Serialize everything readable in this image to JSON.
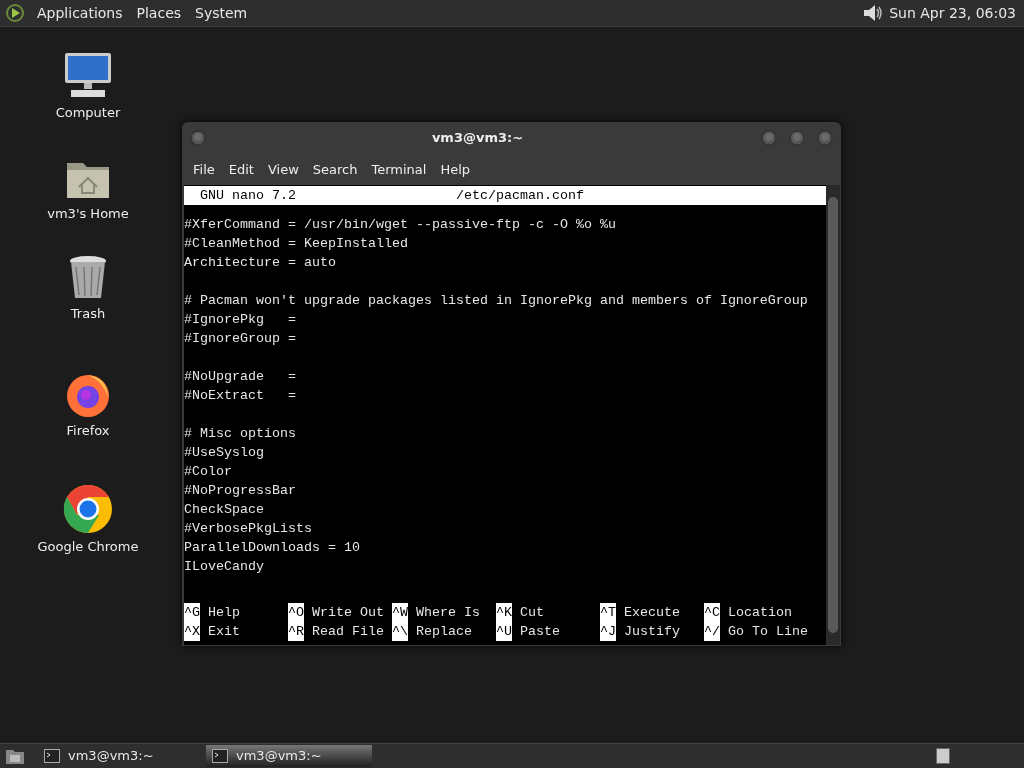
{
  "top_panel": {
    "menus": [
      "Applications",
      "Places",
      "System"
    ],
    "clock": "Sun Apr 23, 06:03"
  },
  "desktop_icons": [
    {
      "kind": "computer",
      "label": "Computer"
    },
    {
      "kind": "home",
      "label": "vm3's Home"
    },
    {
      "kind": "trash",
      "label": "Trash"
    },
    {
      "kind": "firefox",
      "label": "Firefox"
    },
    {
      "kind": "chrome",
      "label": "Google Chrome"
    }
  ],
  "window": {
    "title": "vm3@vm3:~",
    "menu": [
      "File",
      "Edit",
      "View",
      "Search",
      "Terminal",
      "Help"
    ],
    "nano": {
      "version": "GNU nano 7.2",
      "filename": "/etc/pacman.conf",
      "blocks": [
        [
          "#XferCommand = /usr/bin/wget --passive-ftp -c -O %o %u",
          "#CleanMethod = KeepInstalled",
          "Architecture = auto"
        ],
        [
          "# Pacman won't upgrade packages listed in IgnorePkg and members of IgnoreGroup",
          "#IgnorePkg   =",
          "#IgnoreGroup ="
        ],
        [
          "#NoUpgrade   =",
          "#NoExtract   ="
        ],
        [
          "# Misc options",
          "#UseSyslog",
          "#Color",
          "#NoProgressBar",
          "CheckSpace",
          "#VerbosePkgLists",
          "ParallelDownloads = 10",
          "ILoveCandy"
        ]
      ],
      "shortcuts": [
        [
          {
            "key": "^G",
            "label": "Help"
          },
          {
            "key": "^O",
            "label": "Write Out"
          },
          {
            "key": "^W",
            "label": "Where Is"
          },
          {
            "key": "^K",
            "label": "Cut"
          },
          {
            "key": "^T",
            "label": "Execute"
          },
          {
            "key": "^C",
            "label": "Location"
          }
        ],
        [
          {
            "key": "^X",
            "label": "Exit"
          },
          {
            "key": "^R",
            "label": "Read File"
          },
          {
            "key": "^\\",
            "label": "Replace"
          },
          {
            "key": "^U",
            "label": "Paste"
          },
          {
            "key": "^J",
            "label": "Justify"
          },
          {
            "key": "^/",
            "label": "Go To Line"
          }
        ]
      ]
    }
  },
  "taskbar": [
    {
      "label": "vm3@vm3:~",
      "selected": false
    },
    {
      "label": "vm3@vm3:~",
      "selected": true
    }
  ]
}
